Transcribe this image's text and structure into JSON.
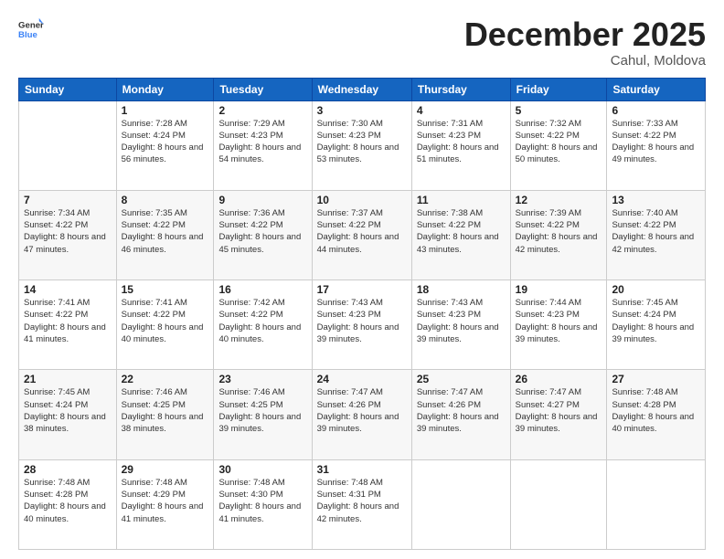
{
  "header": {
    "logo_general": "General",
    "logo_blue": "Blue",
    "title": "December 2025",
    "location": "Cahul, Moldova"
  },
  "days_of_week": [
    "Sunday",
    "Monday",
    "Tuesday",
    "Wednesday",
    "Thursday",
    "Friday",
    "Saturday"
  ],
  "weeks": [
    [
      {
        "day": "",
        "sunrise": "",
        "sunset": "",
        "daylight": ""
      },
      {
        "day": "1",
        "sunrise": "Sunrise: 7:28 AM",
        "sunset": "Sunset: 4:24 PM",
        "daylight": "Daylight: 8 hours and 56 minutes."
      },
      {
        "day": "2",
        "sunrise": "Sunrise: 7:29 AM",
        "sunset": "Sunset: 4:23 PM",
        "daylight": "Daylight: 8 hours and 54 minutes."
      },
      {
        "day": "3",
        "sunrise": "Sunrise: 7:30 AM",
        "sunset": "Sunset: 4:23 PM",
        "daylight": "Daylight: 8 hours and 53 minutes."
      },
      {
        "day": "4",
        "sunrise": "Sunrise: 7:31 AM",
        "sunset": "Sunset: 4:23 PM",
        "daylight": "Daylight: 8 hours and 51 minutes."
      },
      {
        "day": "5",
        "sunrise": "Sunrise: 7:32 AM",
        "sunset": "Sunset: 4:22 PM",
        "daylight": "Daylight: 8 hours and 50 minutes."
      },
      {
        "day": "6",
        "sunrise": "Sunrise: 7:33 AM",
        "sunset": "Sunset: 4:22 PM",
        "daylight": "Daylight: 8 hours and 49 minutes."
      }
    ],
    [
      {
        "day": "7",
        "sunrise": "Sunrise: 7:34 AM",
        "sunset": "Sunset: 4:22 PM",
        "daylight": "Daylight: 8 hours and 47 minutes."
      },
      {
        "day": "8",
        "sunrise": "Sunrise: 7:35 AM",
        "sunset": "Sunset: 4:22 PM",
        "daylight": "Daylight: 8 hours and 46 minutes."
      },
      {
        "day": "9",
        "sunrise": "Sunrise: 7:36 AM",
        "sunset": "Sunset: 4:22 PM",
        "daylight": "Daylight: 8 hours and 45 minutes."
      },
      {
        "day": "10",
        "sunrise": "Sunrise: 7:37 AM",
        "sunset": "Sunset: 4:22 PM",
        "daylight": "Daylight: 8 hours and 44 minutes."
      },
      {
        "day": "11",
        "sunrise": "Sunrise: 7:38 AM",
        "sunset": "Sunset: 4:22 PM",
        "daylight": "Daylight: 8 hours and 43 minutes."
      },
      {
        "day": "12",
        "sunrise": "Sunrise: 7:39 AM",
        "sunset": "Sunset: 4:22 PM",
        "daylight": "Daylight: 8 hours and 42 minutes."
      },
      {
        "day": "13",
        "sunrise": "Sunrise: 7:40 AM",
        "sunset": "Sunset: 4:22 PM",
        "daylight": "Daylight: 8 hours and 42 minutes."
      }
    ],
    [
      {
        "day": "14",
        "sunrise": "Sunrise: 7:41 AM",
        "sunset": "Sunset: 4:22 PM",
        "daylight": "Daylight: 8 hours and 41 minutes."
      },
      {
        "day": "15",
        "sunrise": "Sunrise: 7:41 AM",
        "sunset": "Sunset: 4:22 PM",
        "daylight": "Daylight: 8 hours and 40 minutes."
      },
      {
        "day": "16",
        "sunrise": "Sunrise: 7:42 AM",
        "sunset": "Sunset: 4:22 PM",
        "daylight": "Daylight: 8 hours and 40 minutes."
      },
      {
        "day": "17",
        "sunrise": "Sunrise: 7:43 AM",
        "sunset": "Sunset: 4:23 PM",
        "daylight": "Daylight: 8 hours and 39 minutes."
      },
      {
        "day": "18",
        "sunrise": "Sunrise: 7:43 AM",
        "sunset": "Sunset: 4:23 PM",
        "daylight": "Daylight: 8 hours and 39 minutes."
      },
      {
        "day": "19",
        "sunrise": "Sunrise: 7:44 AM",
        "sunset": "Sunset: 4:23 PM",
        "daylight": "Daylight: 8 hours and 39 minutes."
      },
      {
        "day": "20",
        "sunrise": "Sunrise: 7:45 AM",
        "sunset": "Sunset: 4:24 PM",
        "daylight": "Daylight: 8 hours and 39 minutes."
      }
    ],
    [
      {
        "day": "21",
        "sunrise": "Sunrise: 7:45 AM",
        "sunset": "Sunset: 4:24 PM",
        "daylight": "Daylight: 8 hours and 38 minutes."
      },
      {
        "day": "22",
        "sunrise": "Sunrise: 7:46 AM",
        "sunset": "Sunset: 4:25 PM",
        "daylight": "Daylight: 8 hours and 38 minutes."
      },
      {
        "day": "23",
        "sunrise": "Sunrise: 7:46 AM",
        "sunset": "Sunset: 4:25 PM",
        "daylight": "Daylight: 8 hours and 39 minutes."
      },
      {
        "day": "24",
        "sunrise": "Sunrise: 7:47 AM",
        "sunset": "Sunset: 4:26 PM",
        "daylight": "Daylight: 8 hours and 39 minutes."
      },
      {
        "day": "25",
        "sunrise": "Sunrise: 7:47 AM",
        "sunset": "Sunset: 4:26 PM",
        "daylight": "Daylight: 8 hours and 39 minutes."
      },
      {
        "day": "26",
        "sunrise": "Sunrise: 7:47 AM",
        "sunset": "Sunset: 4:27 PM",
        "daylight": "Daylight: 8 hours and 39 minutes."
      },
      {
        "day": "27",
        "sunrise": "Sunrise: 7:48 AM",
        "sunset": "Sunset: 4:28 PM",
        "daylight": "Daylight: 8 hours and 40 minutes."
      }
    ],
    [
      {
        "day": "28",
        "sunrise": "Sunrise: 7:48 AM",
        "sunset": "Sunset: 4:28 PM",
        "daylight": "Daylight: 8 hours and 40 minutes."
      },
      {
        "day": "29",
        "sunrise": "Sunrise: 7:48 AM",
        "sunset": "Sunset: 4:29 PM",
        "daylight": "Daylight: 8 hours and 41 minutes."
      },
      {
        "day": "30",
        "sunrise": "Sunrise: 7:48 AM",
        "sunset": "Sunset: 4:30 PM",
        "daylight": "Daylight: 8 hours and 41 minutes."
      },
      {
        "day": "31",
        "sunrise": "Sunrise: 7:48 AM",
        "sunset": "Sunset: 4:31 PM",
        "daylight": "Daylight: 8 hours and 42 minutes."
      },
      {
        "day": "",
        "sunrise": "",
        "sunset": "",
        "daylight": ""
      },
      {
        "day": "",
        "sunrise": "",
        "sunset": "",
        "daylight": ""
      },
      {
        "day": "",
        "sunrise": "",
        "sunset": "",
        "daylight": ""
      }
    ]
  ]
}
